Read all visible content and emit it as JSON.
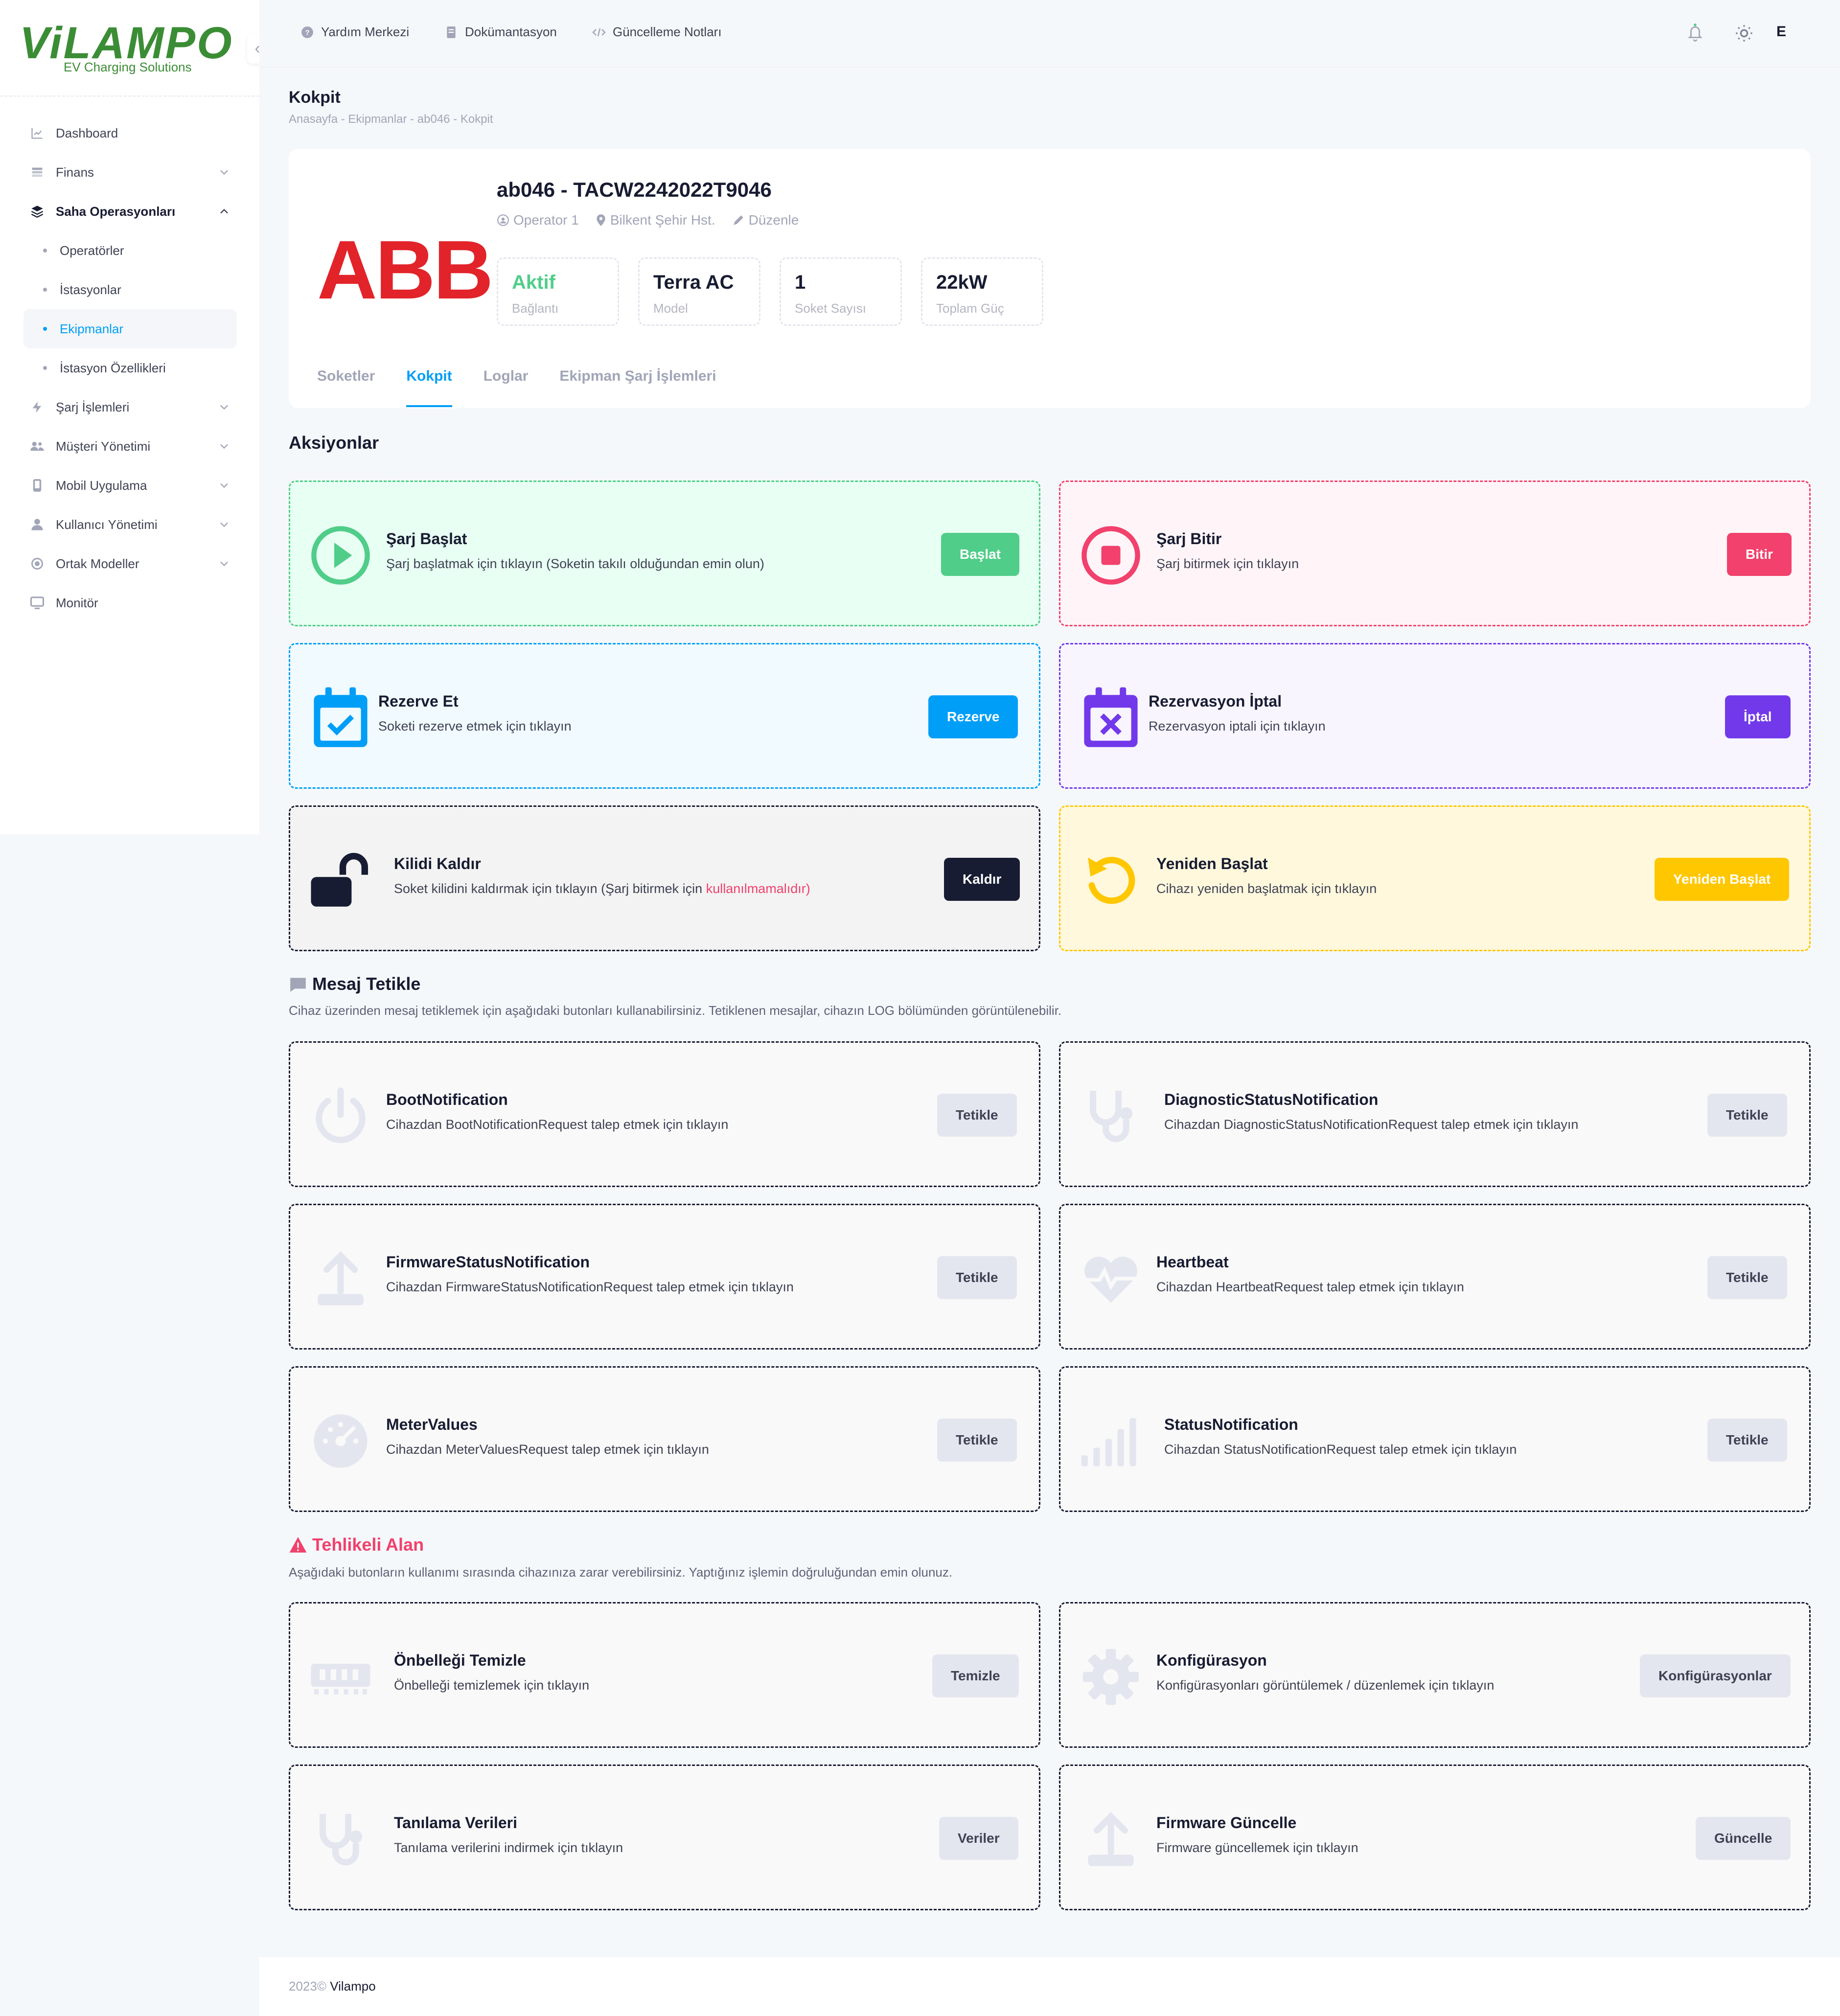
{
  "brand": {
    "name": "ViLAMPO",
    "subtitle": "EV Charging Solutions"
  },
  "sidebar": {
    "items": [
      {
        "label": "Dashboard",
        "icon": "chart-line-icon"
      },
      {
        "label": "Finans",
        "icon": "stack-icon"
      },
      {
        "label": "Saha Operasyonları",
        "icon": "layers-icon"
      },
      {
        "label": "Operatörler"
      },
      {
        "label": "İstasyonlar"
      },
      {
        "label": "Ekipmanlar"
      },
      {
        "label": "İstasyon Özellikleri"
      },
      {
        "label": "Şarj İşlemleri",
        "icon": "bolt-icon"
      },
      {
        "label": "Müşteri Yönetimi",
        "icon": "users-icon"
      },
      {
        "label": "Mobil Uygulama",
        "icon": "phone-icon"
      },
      {
        "label": "Kullanıcı Yönetimi",
        "icon": "user-icon"
      },
      {
        "label": "Ortak Modeller",
        "icon": "circle-icon"
      },
      {
        "label": "Monitör",
        "icon": "monitor-icon"
      }
    ]
  },
  "header": {
    "help": "Yardım Merkezi",
    "docs": "Dokümantasyon",
    "changelog": "Güncelleme Notları",
    "avatar": "E"
  },
  "page": {
    "title": "Kokpit",
    "breadcrumb": "Anasayfa  -  Ekipmanlar  -  ab046  -  Kokpit"
  },
  "equipment": {
    "logo": "ABB",
    "title": "ab046 - TACW2242022T9046",
    "operator": "Operator 1",
    "station": "Bilkent Şehir Hst.",
    "edit": "Düzenle",
    "stats": [
      {
        "value": "Aktif",
        "label": "Bağlantı",
        "color": "#50cd89"
      },
      {
        "value": "Terra AC",
        "label": "Model",
        "color": "#181c32"
      },
      {
        "value": "1",
        "label": "Soket Sayısı",
        "color": "#181c32"
      },
      {
        "value": "22kW",
        "label": "Toplam Güç",
        "color": "#181c32"
      }
    ],
    "tabs": [
      "Soketler",
      "Kokpit",
      "Loglar",
      "Ekipman Şarj İşlemleri"
    ]
  },
  "actions": {
    "heading": "Aksiyonlar",
    "start": {
      "title": "Şarj Başlat",
      "desc": "Şarj başlatmak için tıklayın (Soketin takılı olduğundan emin olun)",
      "button": "Başlat"
    },
    "stop": {
      "title": "Şarj Bitir",
      "desc": "Şarj bitirmek için tıklayın",
      "button": "Bitir"
    },
    "reserve": {
      "title": "Rezerve Et",
      "desc": "Soketi rezerve etmek için tıklayın",
      "button": "Rezerve"
    },
    "cancel": {
      "title": "Rezervasyon İptal",
      "desc": "Rezervasyon iptali için tıklayın",
      "button": "İptal"
    },
    "unlock": {
      "title": "Kilidi Kaldır",
      "desc": "Soket kilidini kaldırmak için tıklayın (Şarj bitirmek için ",
      "desc_warn": "kullanılmamalıdır)",
      "button": "Kaldır"
    },
    "restart": {
      "title": "Yeniden Başlat",
      "desc": "Cihazı yeniden başlatmak için tıklayın",
      "button": "Yeniden Başlat"
    }
  },
  "messages": {
    "heading": "Mesaj Tetikle",
    "desc": "Cihaz üzerinden mesaj tetiklemek için aşağıdaki butonları kullanabilirsiniz. Tetiklenen mesajlar, cihazın LOG bölümünden görüntülenebilir.",
    "boot": {
      "title": "BootNotification",
      "desc": "Cihazdan BootNotificationRequest talep etmek için tıklayın",
      "button": "Tetikle"
    },
    "diag": {
      "title": "DiagnosticStatusNotification",
      "desc": "Cihazdan DiagnosticStatusNotificationRequest talep etmek için tıklayın",
      "button": "Tetikle"
    },
    "firmware": {
      "title": "FirmwareStatusNotification",
      "desc": "Cihazdan FirmwareStatusNotificationRequest talep etmek için tıklayın",
      "button": "Tetikle"
    },
    "heartbeat": {
      "title": "Heartbeat",
      "desc": "Cihazdan HeartbeatRequest talep etmek için tıklayın",
      "button": "Tetikle"
    },
    "meter": {
      "title": "MeterValues",
      "desc": "Cihazdan MeterValuesRequest talep etmek için tıklayın",
      "button": "Tetikle"
    },
    "status": {
      "title": "StatusNotification",
      "desc": "Cihazdan StatusNotificationRequest talep etmek için tıklayın",
      "button": "Tetikle"
    }
  },
  "danger": {
    "heading": "Tehlikeli Alan",
    "desc": "Aşağıdaki butonların kullanımı sırasında cihazınıza zarar verebilirsiniz. Yaptığınız işlemin doğruluğundan emin olunuz.",
    "cache": {
      "title": "Önbelleği Temizle",
      "desc": "Önbelleği temizlemek için tıklayın",
      "button": "Temizle"
    },
    "config": {
      "title": "Konfigürasyon",
      "desc": "Konfigürasyonları görüntülemek / düzenlemek için tıklayın",
      "button": "Konfigürasyonlar"
    },
    "diagdata": {
      "title": "Tanılama Verileri",
      "desc": "Tanılama verilerini indirmek için tıklayın",
      "button": "Veriler"
    },
    "fwupdate": {
      "title": "Firmware Güncelle",
      "desc": "Firmware güncellemek için tıklayın",
      "button": "Güncelle"
    }
  },
  "footer": {
    "year": "2023©",
    "company": "Vilampo"
  },
  "colors": {
    "primary": "#009ef7",
    "success": "#50cd89",
    "danger": "#f1416c",
    "purple": "#7239ea",
    "warning": "#ffc700",
    "dark": "#181c32"
  }
}
